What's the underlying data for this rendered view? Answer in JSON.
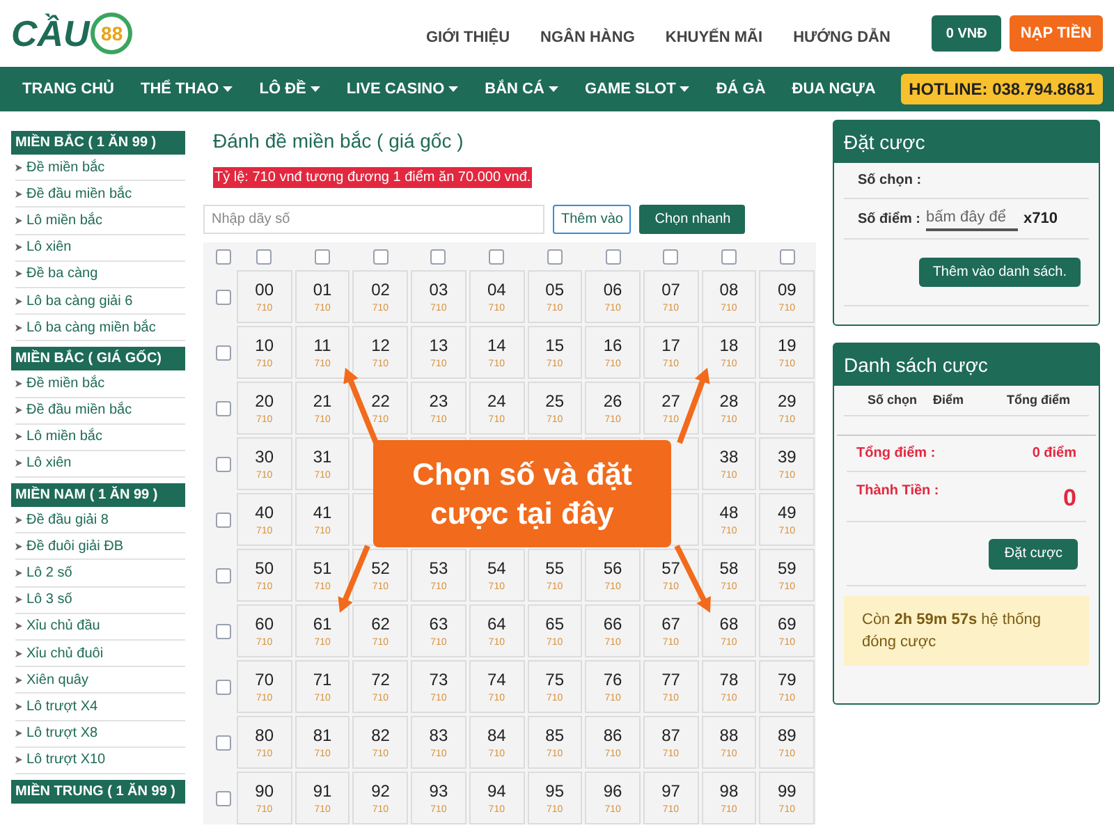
{
  "logo": {
    "text": "CẦU",
    "number": "88"
  },
  "header_links": [
    "GIỚI THIỆU",
    "NGÂN HÀNG",
    "KHUYẾN MÃI",
    "HƯỚNG DẪN"
  ],
  "balance_button": "0 VNĐ",
  "deposit_button": "NẠP TIỀN",
  "nav": [
    {
      "label": "TRANG CHỦ",
      "dropdown": false
    },
    {
      "label": "THỂ THAO",
      "dropdown": true
    },
    {
      "label": "LÔ ĐỀ",
      "dropdown": true
    },
    {
      "label": "LIVE CASINO",
      "dropdown": true
    },
    {
      "label": "BẮN CÁ",
      "dropdown": true
    },
    {
      "label": "GAME SLOT",
      "dropdown": true
    },
    {
      "label": "ĐÁ GÀ",
      "dropdown": false
    },
    {
      "label": "ĐUA NGỰA",
      "dropdown": false
    }
  ],
  "hotline": "HOTLINE: 038.794.8681",
  "sidebar": [
    {
      "title": "MIỀN BẮC ( 1 ĂN 99 )",
      "items": [
        "Đề miền bắc",
        "Đề đầu miền bắc",
        "Lô miền bắc",
        "Lô xiên",
        "Đề ba càng",
        "Lô ba càng giải 6",
        "Lô ba càng miền bắc"
      ]
    },
    {
      "title": "MIỀN BẮC ( GIÁ GỐC)",
      "items": [
        "Đề miền bắc",
        "Đề đầu miền bắc",
        "Lô miền bắc",
        "Lô xiên"
      ]
    },
    {
      "title": "MIỀN NAM ( 1 ĂN 99 )",
      "items": [
        "Đề đầu giải 8",
        "Đề đuôi giải ĐB",
        "Lô 2 số",
        "Lô 3 số",
        "Xỉu chủ đầu",
        "Xỉu chủ đuôi",
        "Xiên quây",
        "Lô trượt X4",
        "Lô trượt X8",
        "Lô trượt X10"
      ]
    },
    {
      "title": "MIỀN TRUNG ( 1 ĂN 99 )"
    }
  ],
  "main": {
    "title": "Đánh đề miền bắc ( giá gốc )",
    "rate": "Tỷ lệ: 710 vnđ tương đương 1 điểm ăn 70.000 vnđ.",
    "input": {
      "placeholder": "Nhập dãy số"
    },
    "add_button": "Thêm vào",
    "quick_button": "Chọn nhanh",
    "column_checks": [
      {
        "checked": false
      },
      {
        "checked": false
      },
      {
        "checked": false
      },
      {
        "checked": false
      },
      {
        "checked": false
      },
      {
        "checked": false
      },
      {
        "checked": false
      },
      {
        "checked": false
      },
      {
        "checked": false
      },
      {
        "checked": false
      },
      {
        "checked": false
      }
    ],
    "rows": [
      {
        "checked": false,
        "cells": [
          {
            "kind": "number",
            "number": "00",
            "price": "710"
          },
          {
            "kind": "number",
            "number": "01",
            "price": "710"
          },
          {
            "kind": "number",
            "number": "02",
            "price": "710"
          },
          {
            "kind": "number",
            "number": "03",
            "price": "710"
          },
          {
            "kind": "number",
            "number": "04",
            "price": "710"
          },
          {
            "kind": "number",
            "number": "05",
            "price": "710"
          },
          {
            "kind": "number",
            "number": "06",
            "price": "710"
          },
          {
            "kind": "number",
            "number": "07",
            "price": "710"
          },
          {
            "kind": "number",
            "number": "08",
            "price": "710"
          },
          {
            "kind": "number",
            "number": "09",
            "price": "710"
          }
        ]
      },
      {
        "checked": false,
        "cells": [
          {
            "kind": "number",
            "number": "10",
            "price": "710"
          },
          {
            "kind": "number",
            "number": "11",
            "price": "710"
          },
          {
            "kind": "number",
            "number": "12",
            "price": "710"
          },
          {
            "kind": "number",
            "number": "13",
            "price": "710"
          },
          {
            "kind": "number",
            "number": "14",
            "price": "710"
          },
          {
            "kind": "number",
            "number": "15",
            "price": "710"
          },
          {
            "kind": "number",
            "number": "16",
            "price": "710"
          },
          {
            "kind": "number",
            "number": "17",
            "price": "710"
          },
          {
            "kind": "number",
            "number": "18",
            "price": "710"
          },
          {
            "kind": "number",
            "number": "19",
            "price": "710"
          }
        ]
      },
      {
        "checked": false,
        "cells": [
          {
            "kind": "number",
            "number": "20",
            "price": "710"
          },
          {
            "kind": "number",
            "number": "21",
            "price": "710"
          },
          {
            "kind": "number",
            "number": "22",
            "price": "710"
          },
          {
            "kind": "number",
            "number": "23",
            "price": "710"
          },
          {
            "kind": "number",
            "number": "24",
            "price": "710"
          },
          {
            "kind": "number",
            "number": "25",
            "price": "710"
          },
          {
            "kind": "number",
            "number": "26",
            "price": "710"
          },
          {
            "kind": "number",
            "number": "27",
            "price": "710"
          },
          {
            "kind": "number",
            "number": "28",
            "price": "710"
          },
          {
            "kind": "number",
            "number": "29",
            "price": "710"
          }
        ]
      },
      {
        "checked": false,
        "cells": [
          {
            "kind": "number",
            "number": "30",
            "price": "710"
          },
          {
            "kind": "number",
            "number": "31",
            "price": "710"
          },
          {
            "kind": "covered"
          },
          {
            "kind": "covered"
          },
          {
            "kind": "covered"
          },
          {
            "kind": "covered"
          },
          {
            "kind": "covered"
          },
          {
            "kind": "covered"
          },
          {
            "kind": "number",
            "number": "38",
            "price": "710"
          },
          {
            "kind": "number",
            "number": "39",
            "price": "710"
          }
        ]
      },
      {
        "checked": false,
        "cells": [
          {
            "kind": "number",
            "number": "40",
            "price": "710"
          },
          {
            "kind": "number",
            "number": "41",
            "price": "710"
          },
          {
            "kind": "covered"
          },
          {
            "kind": "hidden"
          },
          {
            "kind": "hidden"
          },
          {
            "kind": "hidden"
          },
          {
            "kind": "hidden"
          },
          {
            "kind": "covered"
          },
          {
            "kind": "number",
            "number": "48",
            "price": "710"
          },
          {
            "kind": "number",
            "number": "49",
            "price": "710"
          }
        ]
      },
      {
        "checked": false,
        "cells": [
          {
            "kind": "number",
            "number": "50",
            "price": "710"
          },
          {
            "kind": "number",
            "number": "51",
            "price": "710"
          },
          {
            "kind": "number",
            "number": "52",
            "price": "710"
          },
          {
            "kind": "number",
            "number": "53",
            "price": "710"
          },
          {
            "kind": "number",
            "number": "54",
            "price": "710"
          },
          {
            "kind": "number",
            "number": "55",
            "price": "710"
          },
          {
            "kind": "number",
            "number": "56",
            "price": "710"
          },
          {
            "kind": "number",
            "number": "57",
            "price": "710"
          },
          {
            "kind": "number",
            "number": "58",
            "price": "710"
          },
          {
            "kind": "number",
            "number": "59",
            "price": "710"
          }
        ]
      },
      {
        "checked": false,
        "cells": [
          {
            "kind": "number",
            "number": "60",
            "price": "710"
          },
          {
            "kind": "number",
            "number": "61",
            "price": "710"
          },
          {
            "kind": "number",
            "number": "62",
            "price": "710"
          },
          {
            "kind": "number",
            "number": "63",
            "price": "710"
          },
          {
            "kind": "number",
            "number": "64",
            "price": "710"
          },
          {
            "kind": "number",
            "number": "65",
            "price": "710"
          },
          {
            "kind": "number",
            "number": "66",
            "price": "710"
          },
          {
            "kind": "number",
            "number": "67",
            "price": "710"
          },
          {
            "kind": "number",
            "number": "68",
            "price": "710"
          },
          {
            "kind": "number",
            "number": "69",
            "price": "710"
          }
        ]
      },
      {
        "checked": false,
        "cells": [
          {
            "kind": "number",
            "number": "70",
            "price": "710"
          },
          {
            "kind": "number",
            "number": "71",
            "price": "710"
          },
          {
            "kind": "number",
            "number": "72",
            "price": "710"
          },
          {
            "kind": "number",
            "number": "73",
            "price": "710"
          },
          {
            "kind": "number",
            "number": "74",
            "price": "710"
          },
          {
            "kind": "number",
            "number": "75",
            "price": "710"
          },
          {
            "kind": "number",
            "number": "76",
            "price": "710"
          },
          {
            "kind": "number",
            "number": "77",
            "price": "710"
          },
          {
            "kind": "number",
            "number": "78",
            "price": "710"
          },
          {
            "kind": "number",
            "number": "79",
            "price": "710"
          }
        ]
      },
      {
        "checked": false,
        "cells": [
          {
            "kind": "number",
            "number": "80",
            "price": "710"
          },
          {
            "kind": "number",
            "number": "81",
            "price": "710"
          },
          {
            "kind": "number",
            "number": "82",
            "price": "710"
          },
          {
            "kind": "number",
            "number": "83",
            "price": "710"
          },
          {
            "kind": "number",
            "number": "84",
            "price": "710"
          },
          {
            "kind": "number",
            "number": "85",
            "price": "710"
          },
          {
            "kind": "number",
            "number": "86",
            "price": "710"
          },
          {
            "kind": "number",
            "number": "87",
            "price": "710"
          },
          {
            "kind": "number",
            "number": "88",
            "price": "710"
          },
          {
            "kind": "number",
            "number": "89",
            "price": "710"
          }
        ]
      },
      {
        "checked": false,
        "cells": [
          {
            "kind": "number",
            "number": "90",
            "price": "710"
          },
          {
            "kind": "number",
            "number": "91",
            "price": "710"
          },
          {
            "kind": "number",
            "number": "92",
            "price": "710"
          },
          {
            "kind": "number",
            "number": "93",
            "price": "710"
          },
          {
            "kind": "number",
            "number": "94",
            "price": "710"
          },
          {
            "kind": "number",
            "number": "95",
            "price": "710"
          },
          {
            "kind": "number",
            "number": "96",
            "price": "710"
          },
          {
            "kind": "number",
            "number": "97",
            "price": "710"
          },
          {
            "kind": "number",
            "number": "98",
            "price": "710"
          },
          {
            "kind": "number",
            "number": "99",
            "price": "710"
          }
        ]
      }
    ]
  },
  "callout": "Chọn số và đặt cược tại đây",
  "bet": {
    "title": "Đặt cược",
    "pick_label": "Số chọn :",
    "points_label": "Số điểm :",
    "points_placeholder": "bấm đây để",
    "multiplier": "x710",
    "add_button": "Thêm vào danh sách."
  },
  "bet_list": {
    "title": "Danh sách cược",
    "columns": [
      "Số chọn",
      "Điểm",
      "Tổng điểm"
    ],
    "total_label": "Tổng điểm :",
    "total_value": "0 điểm",
    "amount_label": "Thành Tiền :",
    "amount_value": "0",
    "place_button": "Đặt cược",
    "notice": "Còn **2h 59m 57s** hệ thống đóng cược"
  }
}
